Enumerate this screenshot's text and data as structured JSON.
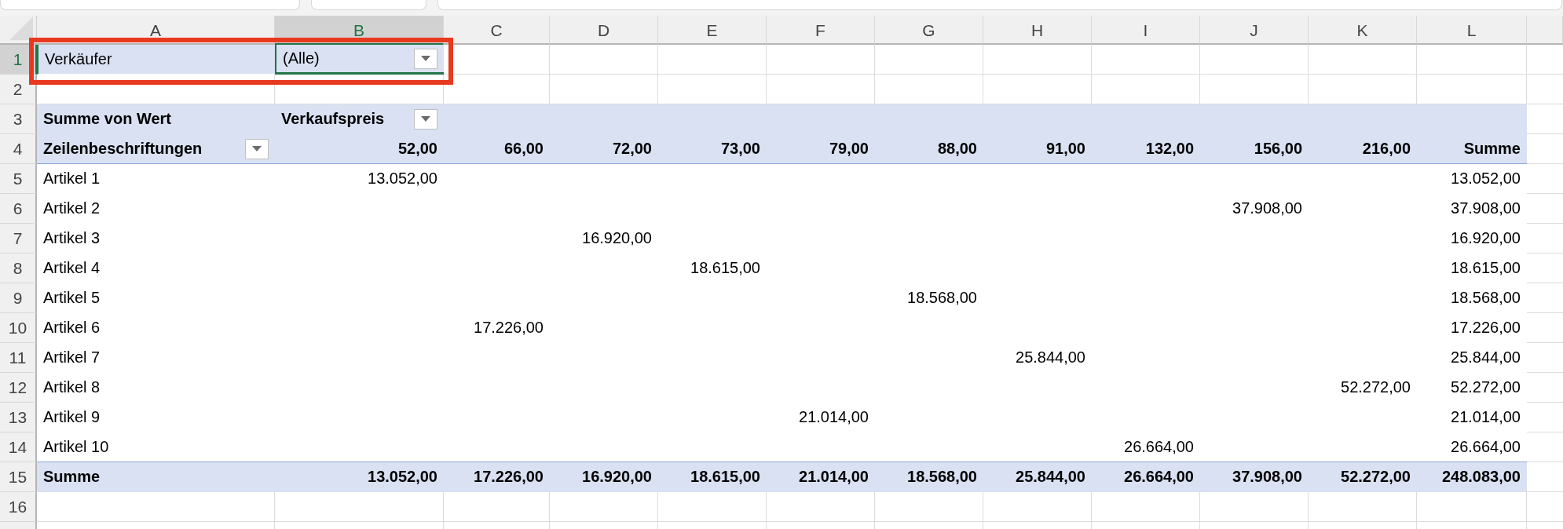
{
  "column_headers": [
    {
      "label": "A",
      "selected": false
    },
    {
      "label": "B",
      "selected": true
    },
    {
      "label": "C",
      "selected": false
    },
    {
      "label": "D",
      "selected": false
    },
    {
      "label": "E",
      "selected": false
    },
    {
      "label": "F",
      "selected": false
    },
    {
      "label": "G",
      "selected": false
    },
    {
      "label": "H",
      "selected": false
    },
    {
      "label": "I",
      "selected": false
    },
    {
      "label": "J",
      "selected": false
    },
    {
      "label": "K",
      "selected": false
    },
    {
      "label": "L",
      "selected": false
    }
  ],
  "row_headers": [
    {
      "label": "1",
      "selected": true
    },
    {
      "label": "2",
      "selected": false
    },
    {
      "label": "3",
      "selected": false
    },
    {
      "label": "4",
      "selected": false
    },
    {
      "label": "5",
      "selected": false
    },
    {
      "label": "6",
      "selected": false
    },
    {
      "label": "7",
      "selected": false
    },
    {
      "label": "8",
      "selected": false
    },
    {
      "label": "9",
      "selected": false
    },
    {
      "label": "10",
      "selected": false
    },
    {
      "label": "11",
      "selected": false
    },
    {
      "label": "12",
      "selected": false
    },
    {
      "label": "13",
      "selected": false
    },
    {
      "label": "14",
      "selected": false
    },
    {
      "label": "15",
      "selected": false
    },
    {
      "label": "16",
      "selected": false
    }
  ],
  "filter": {
    "label": "Verkäufer",
    "value": "(Alle)"
  },
  "pivot": {
    "value_label": "Summe von Wert",
    "column_field": "Verkaufspreis",
    "row_field": "Zeilenbeschriftungen",
    "columns": [
      "52,00",
      "66,00",
      "72,00",
      "73,00",
      "79,00",
      "88,00",
      "91,00",
      "132,00",
      "156,00",
      "216,00"
    ],
    "total_label": "Summe",
    "rows": [
      {
        "label": "Artikel 1",
        "cells": [
          {
            "kind": "value",
            "text": "13.052,00"
          },
          {
            "kind": "empty"
          },
          {
            "kind": "empty"
          },
          {
            "kind": "empty"
          },
          {
            "kind": "empty"
          },
          {
            "kind": "empty"
          },
          {
            "kind": "empty"
          },
          {
            "kind": "empty"
          },
          {
            "kind": "empty"
          },
          {
            "kind": "empty"
          }
        ],
        "total": "13.052,00"
      },
      {
        "label": "Artikel 2",
        "cells": [
          {
            "kind": "empty"
          },
          {
            "kind": "empty"
          },
          {
            "kind": "empty"
          },
          {
            "kind": "empty"
          },
          {
            "kind": "empty"
          },
          {
            "kind": "empty"
          },
          {
            "kind": "empty"
          },
          {
            "kind": "empty"
          },
          {
            "kind": "value",
            "text": "37.908,00"
          },
          {
            "kind": "empty"
          }
        ],
        "total": "37.908,00"
      },
      {
        "label": "Artikel 3",
        "cells": [
          {
            "kind": "empty"
          },
          {
            "kind": "empty"
          },
          {
            "kind": "value",
            "text": "16.920,00"
          },
          {
            "kind": "empty"
          },
          {
            "kind": "empty"
          },
          {
            "kind": "empty"
          },
          {
            "kind": "empty"
          },
          {
            "kind": "empty"
          },
          {
            "kind": "empty"
          },
          {
            "kind": "empty"
          }
        ],
        "total": "16.920,00"
      },
      {
        "label": "Artikel 4",
        "cells": [
          {
            "kind": "empty"
          },
          {
            "kind": "empty"
          },
          {
            "kind": "empty"
          },
          {
            "kind": "value",
            "text": "18.615,00"
          },
          {
            "kind": "empty"
          },
          {
            "kind": "empty"
          },
          {
            "kind": "empty"
          },
          {
            "kind": "empty"
          },
          {
            "kind": "empty"
          },
          {
            "kind": "empty"
          }
        ],
        "total": "18.615,00"
      },
      {
        "label": "Artikel 5",
        "cells": [
          {
            "kind": "empty"
          },
          {
            "kind": "empty"
          },
          {
            "kind": "empty"
          },
          {
            "kind": "empty"
          },
          {
            "kind": "empty"
          },
          {
            "kind": "value",
            "text": "18.568,00"
          },
          {
            "kind": "empty"
          },
          {
            "kind": "empty"
          },
          {
            "kind": "empty"
          },
          {
            "kind": "empty"
          }
        ],
        "total": "18.568,00"
      },
      {
        "label": "Artikel 6",
        "cells": [
          {
            "kind": "empty"
          },
          {
            "kind": "value",
            "text": "17.226,00"
          },
          {
            "kind": "empty"
          },
          {
            "kind": "empty"
          },
          {
            "kind": "empty"
          },
          {
            "kind": "empty"
          },
          {
            "kind": "empty"
          },
          {
            "kind": "empty"
          },
          {
            "kind": "empty"
          },
          {
            "kind": "empty"
          }
        ],
        "total": "17.226,00"
      },
      {
        "label": "Artikel 7",
        "cells": [
          {
            "kind": "empty"
          },
          {
            "kind": "empty"
          },
          {
            "kind": "empty"
          },
          {
            "kind": "empty"
          },
          {
            "kind": "empty"
          },
          {
            "kind": "empty"
          },
          {
            "kind": "value",
            "text": "25.844,00"
          },
          {
            "kind": "empty"
          },
          {
            "kind": "empty"
          },
          {
            "kind": "empty"
          }
        ],
        "total": "25.844,00"
      },
      {
        "label": "Artikel 8",
        "cells": [
          {
            "kind": "empty"
          },
          {
            "kind": "empty"
          },
          {
            "kind": "empty"
          },
          {
            "kind": "empty"
          },
          {
            "kind": "empty"
          },
          {
            "kind": "empty"
          },
          {
            "kind": "empty"
          },
          {
            "kind": "empty"
          },
          {
            "kind": "empty"
          },
          {
            "kind": "value",
            "text": "52.272,00"
          }
        ],
        "total": "52.272,00"
      },
      {
        "label": "Artikel 9",
        "cells": [
          {
            "kind": "empty"
          },
          {
            "kind": "empty"
          },
          {
            "kind": "empty"
          },
          {
            "kind": "empty"
          },
          {
            "kind": "value",
            "text": "21.014,00"
          },
          {
            "kind": "empty"
          },
          {
            "kind": "empty"
          },
          {
            "kind": "empty"
          },
          {
            "kind": "empty"
          },
          {
            "kind": "empty"
          }
        ],
        "total": "21.014,00"
      },
      {
        "label": "Artikel 10",
        "cells": [
          {
            "kind": "empty"
          },
          {
            "kind": "empty"
          },
          {
            "kind": "empty"
          },
          {
            "kind": "empty"
          },
          {
            "kind": "empty"
          },
          {
            "kind": "empty"
          },
          {
            "kind": "empty"
          },
          {
            "kind": "value",
            "text": "26.664,00"
          },
          {
            "kind": "empty"
          },
          {
            "kind": "empty"
          }
        ],
        "total": "26.664,00"
      }
    ],
    "grand_total": {
      "label": "Summe",
      "values": [
        "13.052,00",
        "17.226,00",
        "16.920,00",
        "18.615,00",
        "21.014,00",
        "18.568,00",
        "25.844,00",
        "26.664,00",
        "37.908,00",
        "52.272,00"
      ],
      "total": "248.083,00"
    }
  }
}
